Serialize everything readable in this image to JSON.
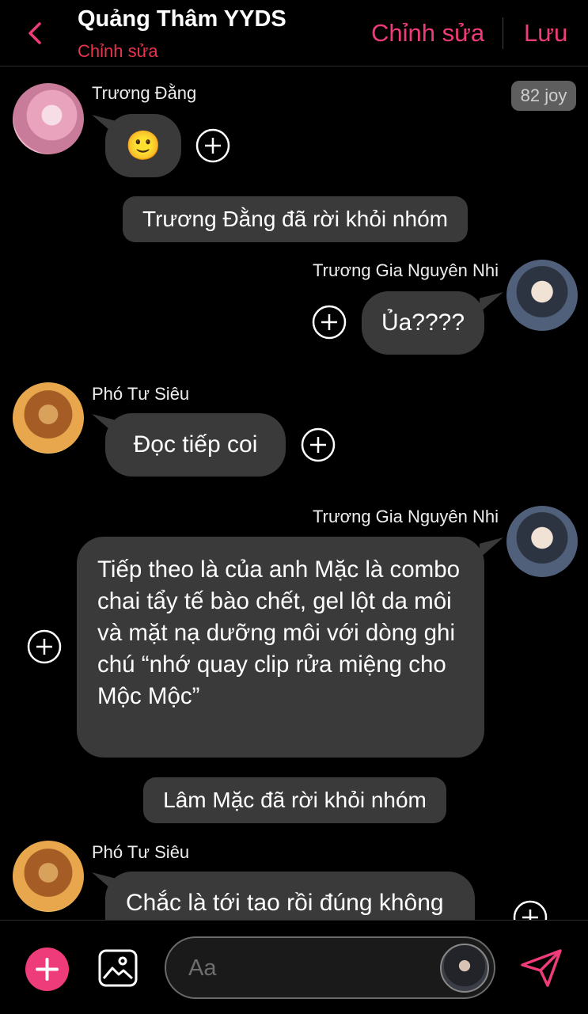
{
  "header": {
    "title": "Quảng Thâm YYDS",
    "subtitle": "Chỉnh sửa",
    "edit_label": "Chỉnh sửa",
    "save_label": "Lưu"
  },
  "joy_badge": "82 joy",
  "messages": [
    {
      "sender": "Trương Đằng",
      "text": "🙂",
      "side": "left"
    },
    {
      "system": "Trương Đằng đã rời khỏi nhóm"
    },
    {
      "sender": "Trương Gia Nguyên Nhi",
      "text": "Ủa????",
      "side": "right"
    },
    {
      "sender": "Phó Tư Siêu",
      "text": "Đọc tiếp coi",
      "side": "left"
    },
    {
      "sender": "Trương Gia Nguyên Nhi",
      "text": "Tiếp theo là của anh Mặc là combo chai tẩy tế bào chết, gel lột da môi và mặt nạ dưỡng môi với dòng ghi chú “nhớ quay clip rửa miệng cho Mộc Mộc”",
      "side": "right"
    },
    {
      "system": "Lâm Mặc đã rời khỏi nhóm"
    },
    {
      "sender": "Phó Tư Siêu",
      "text": "Chắc là tới tao rồi đúng không",
      "side": "left"
    }
  ],
  "composer": {
    "placeholder": "Aa"
  },
  "colors": {
    "accent": "#ee3b79",
    "subtitle": "#e8344c",
    "bubble": "#3a3a3a",
    "background": "#000000"
  },
  "icons": [
    "back-chevron-icon",
    "add-reaction-icon",
    "plus-icon",
    "image-icon",
    "sticker-avatar",
    "send-icon"
  ]
}
